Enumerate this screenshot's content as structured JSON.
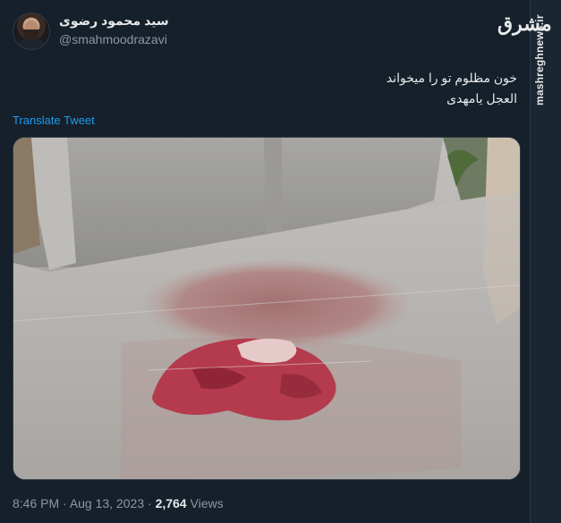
{
  "tweet": {
    "display_name": "سید محمود رضوی",
    "handle": "@smahmoodrazavi",
    "text_lines": [
      "خون مظلوم تو را میخواند",
      "العجل یامهدی"
    ],
    "translate_label": "Translate Tweet",
    "time": "8:46 PM",
    "date": "Aug 13, 2023",
    "views_count": "2,764",
    "views_label": "Views"
  },
  "watermark": {
    "logo_text": "مشرق",
    "site_text": "mashreghnews.ir"
  }
}
